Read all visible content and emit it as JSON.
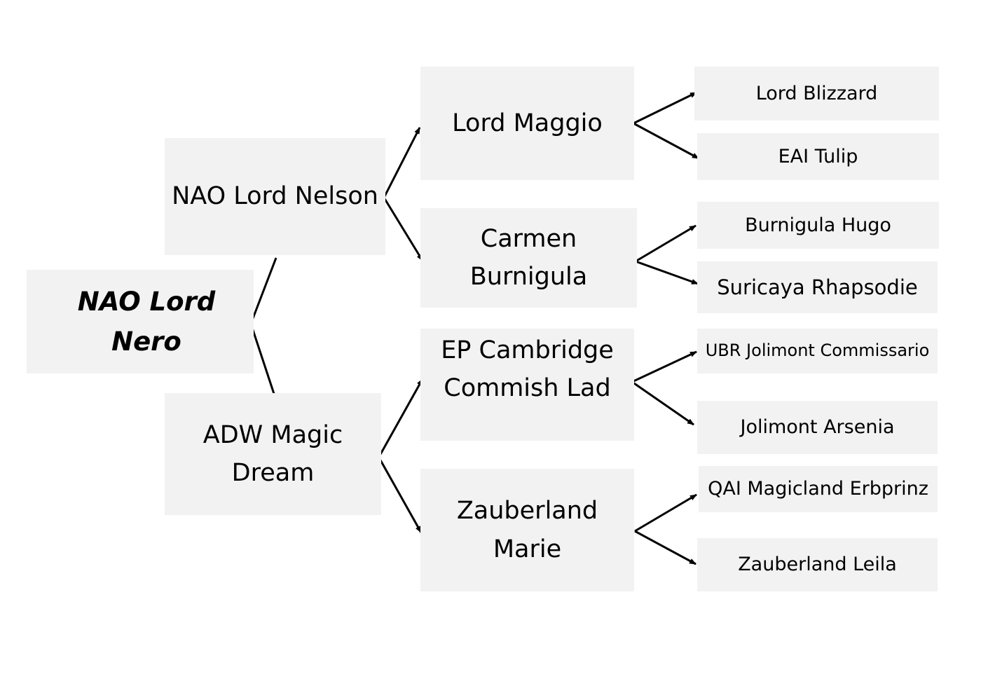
{
  "diagram": {
    "type": "pedigree-tree",
    "root": {
      "id": "root",
      "label": "NAO Lord Nero",
      "style": "bold-italic"
    },
    "nodes": {
      "sire": {
        "label": "NAO Lord Nelson"
      },
      "dam": {
        "label": "ADW Magic\nDream"
      },
      "sire_sire": {
        "label": "Lord Maggio"
      },
      "sire_dam": {
        "label": "Carmen\nBurnigula"
      },
      "dam_sire": {
        "label": "EP Cambridge\nCommish Lad"
      },
      "dam_dam": {
        "label": "Zauberland\nMarie"
      },
      "ss_sire": {
        "label": "Lord Blizzard"
      },
      "ss_dam": {
        "label": "EAI Tulip"
      },
      "sd_sire": {
        "label": "Burnigula Hugo"
      },
      "sd_dam": {
        "label": "Suricaya Rhapsodie"
      },
      "ds_sire": {
        "label": "UBR Jolimont Commissario"
      },
      "ds_dam": {
        "label": "Jolimont Arsenia"
      },
      "dd_sire": {
        "label": "QAI Magicland Erbprinz"
      },
      "dd_dam": {
        "label": "Zauberland Leila"
      }
    },
    "edges": [
      {
        "from": "root",
        "to": "sire",
        "arrow": false
      },
      {
        "from": "root",
        "to": "dam",
        "arrow": false
      },
      {
        "from": "sire",
        "to": "sire_sire",
        "arrow": true
      },
      {
        "from": "sire",
        "to": "sire_dam",
        "arrow": true
      },
      {
        "from": "dam",
        "to": "dam_sire",
        "arrow": true
      },
      {
        "from": "dam",
        "to": "dam_dam",
        "arrow": true
      },
      {
        "from": "sire_sire",
        "to": "ss_sire",
        "arrow": true
      },
      {
        "from": "sire_sire",
        "to": "ss_dam",
        "arrow": true
      },
      {
        "from": "sire_dam",
        "to": "sd_sire",
        "arrow": true
      },
      {
        "from": "sire_dam",
        "to": "sd_dam",
        "arrow": true
      },
      {
        "from": "dam_sire",
        "to": "ds_sire",
        "arrow": true
      },
      {
        "from": "dam_sire",
        "to": "ds_dam",
        "arrow": true
      },
      {
        "from": "dam_dam",
        "to": "dd_sire",
        "arrow": true
      },
      {
        "from": "dam_dam",
        "to": "dd_dam",
        "arrow": true
      }
    ],
    "colors": {
      "box_fill": "#f2f2f2",
      "line": "#000000",
      "text": "#000000"
    }
  }
}
